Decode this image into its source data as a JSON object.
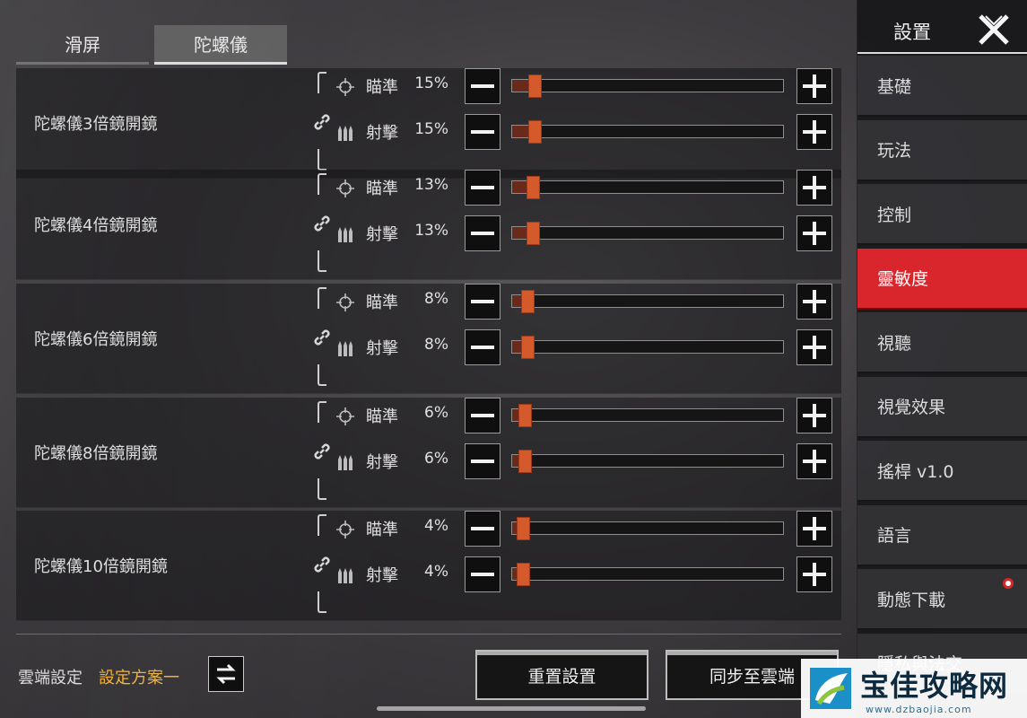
{
  "tabs": [
    {
      "label": "滑屏",
      "active": false
    },
    {
      "label": "陀螺儀",
      "active": true
    }
  ],
  "rows": [
    {
      "label": "陀螺儀3倍鏡開鏡",
      "aim": {
        "name": "瞄準",
        "value": "15%",
        "level": 0.15
      },
      "fire": {
        "name": "射擊",
        "value": "15%",
        "level": 0.15
      }
    },
    {
      "label": "陀螺儀4倍鏡開鏡",
      "aim": {
        "name": "瞄準",
        "value": "13%",
        "level": 0.13
      },
      "fire": {
        "name": "射擊",
        "value": "13%",
        "level": 0.13
      }
    },
    {
      "label": "陀螺儀6倍鏡開鏡",
      "aim": {
        "name": "瞄準",
        "value": "8%",
        "level": 0.08
      },
      "fire": {
        "name": "射擊",
        "value": "8%",
        "level": 0.08
      }
    },
    {
      "label": "陀螺儀8倍鏡開鏡",
      "aim": {
        "name": "瞄準",
        "value": "6%",
        "level": 0.06
      },
      "fire": {
        "name": "射擊",
        "value": "6%",
        "level": 0.06
      }
    },
    {
      "label": "陀螺儀10倍鏡開鏡",
      "aim": {
        "name": "瞄準",
        "value": "4%",
        "level": 0.04
      },
      "fire": {
        "name": "射擊",
        "value": "4%",
        "level": 0.04
      }
    }
  ],
  "cloud": {
    "label": "雲端設定",
    "value": "設定方案一"
  },
  "buttons": {
    "reset": "重置設置",
    "sync": "同步至雲端"
  },
  "sidebar": {
    "title": "設置",
    "items": [
      {
        "label": "基礎",
        "active": false
      },
      {
        "label": "玩法",
        "active": false
      },
      {
        "label": "控制",
        "active": false
      },
      {
        "label": "靈敏度",
        "active": true
      },
      {
        "label": "視聽",
        "active": false
      },
      {
        "label": "視覺效果",
        "active": false
      },
      {
        "label": "搖桿 v1.0",
        "active": false
      },
      {
        "label": "語言",
        "active": false
      },
      {
        "label": "動態下載",
        "active": false,
        "notification": true
      },
      {
        "label": "隱私與法交",
        "active": false
      }
    ]
  },
  "watermark": {
    "name": "宝佳攻略网",
    "url": "www.dzbaojia.com"
  },
  "colors": {
    "accent_red": "#d9262c",
    "slider_thumb": "#d45a2b",
    "cloud_value": "#f0b23b"
  },
  "icons": {
    "aim": "crosshair-icon",
    "fire": "ammo-icon",
    "link": "link-icon",
    "swap": "swap-icon",
    "close": "close-icon"
  }
}
